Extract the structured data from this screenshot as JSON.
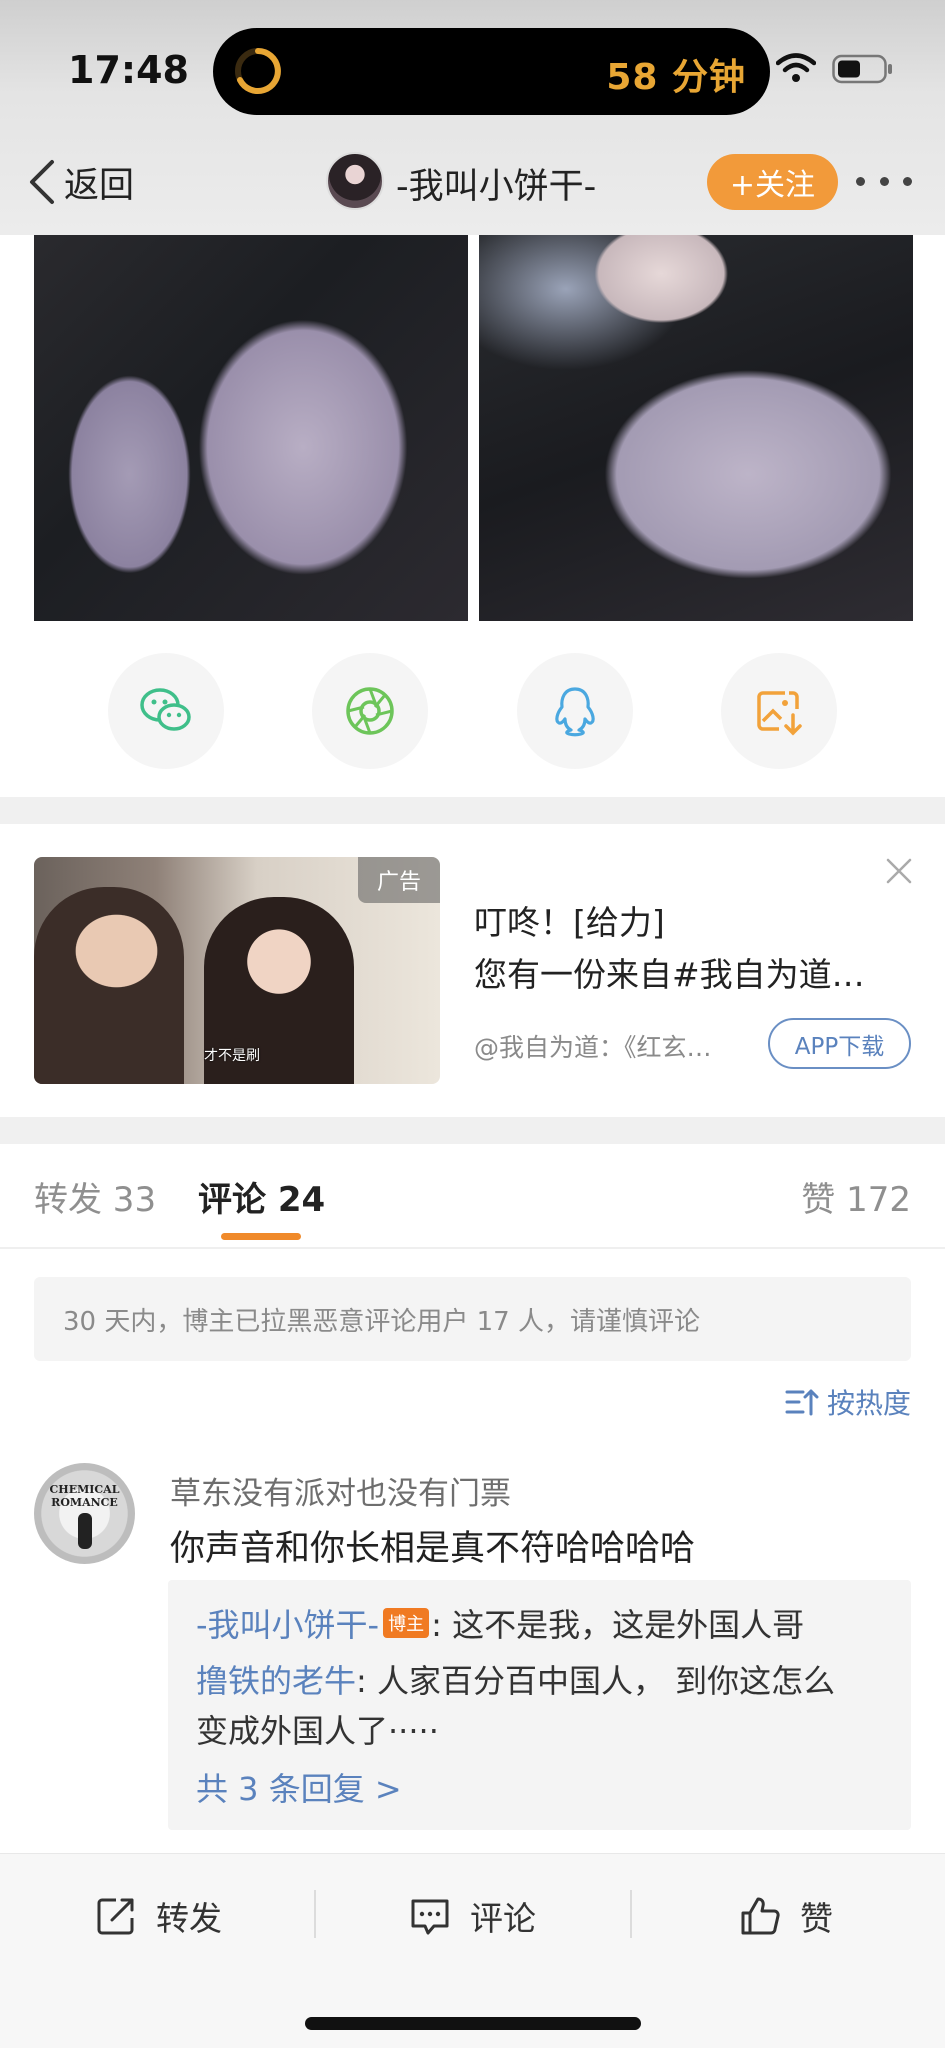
{
  "status_bar": {
    "time": "17:48",
    "island_text": "58 分钟",
    "icons": [
      "timer-ring-icon",
      "wifi-icon",
      "battery-icon"
    ]
  },
  "nav": {
    "back_label": "返回",
    "title": "-我叫小饼干-",
    "follow_label": "+关注",
    "accent_color": "#f29a3a"
  },
  "share": {
    "items": [
      "wechat-icon",
      "moments-icon",
      "qq-icon",
      "save-image-icon"
    ]
  },
  "ad": {
    "badge": "广告",
    "caption": "才不是刷",
    "title_line1": "叮咚！[给力]",
    "title_line2": "您有一份来自#我自为道…",
    "source": "@我自为道：《红玄…",
    "download_label": "APP下载"
  },
  "tabs": {
    "repost": "转发 33",
    "comment": "评论 24",
    "like": "赞 172"
  },
  "notice": "30 天内，博主已拉黑恶意评论用户 17 人，请谨慎评论",
  "sort_label": "按热度",
  "comment": {
    "avatar_text": "CHEMICAL ROMANCE",
    "username": "草东没有派对也没有门票",
    "text": "你声音和你长相是真不符哈哈哈哈",
    "replies": [
      {
        "name": "-我叫小饼干-",
        "badge": "博主",
        "text": ": 这不是我，这是外国人哥"
      },
      {
        "name": "撸铁的老牛",
        "text": ": 人家百分百中国人， 到你这怎么"
      },
      {
        "text": "变成外国人了·····"
      }
    ],
    "more_replies": "共 3 条回复 >"
  },
  "bottom_bar": {
    "repost": "转发",
    "comment": "评论",
    "like": "赞"
  },
  "colors": {
    "link_blue": "#5a82bd",
    "tab_underline": "#f08a2a"
  }
}
